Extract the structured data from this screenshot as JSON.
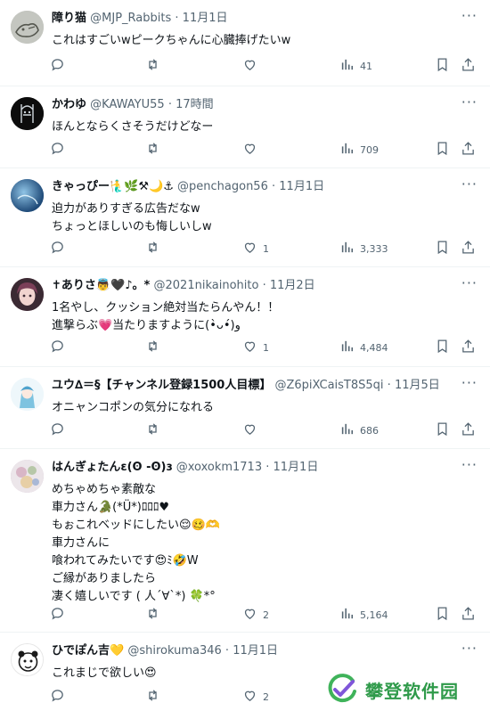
{
  "tweets": [
    {
      "name": "障り猫",
      "handle": "@MJP_Rabbits",
      "time": "11月1日",
      "lines": [
        "これはすごいwピークちゃんに心臓捧げたいw"
      ],
      "replies": "",
      "retweets": "",
      "likes": "",
      "views": "41",
      "avatar_color": "#b8bab4"
    },
    {
      "name": "かわゆ",
      "handle": "@KAWAYU55",
      "time": "17時間",
      "lines": [
        "ほんとならくさそうだけどなー"
      ],
      "replies": "",
      "retweets": "",
      "likes": "",
      "views": "709",
      "avatar_color": "#111111"
    },
    {
      "name": "きゃっぴー🧜‍♂️🌿⚒🌙⚓",
      "handle": "@penchagon56",
      "time": "11月1日",
      "lines": [
        "迫力がありすぎる広告だなw",
        "ちょっとほしいのも悔しいしw"
      ],
      "replies": "",
      "retweets": "",
      "likes": "1",
      "views": "3,333",
      "avatar_color": "#2e5f8f"
    },
    {
      "name": "✝ありさ👼🖤♪。*",
      "handle": "@2021nikainohito",
      "time": "11月2日",
      "lines": [
        "1名やし、クッション絶対当たらんやん！！",
        "進撃らぶ💗当たりますように(•̀ᴗ•́)و"
      ],
      "replies": "",
      "retweets": "",
      "likes": "1",
      "views": "4,484",
      "avatar_color": "#8a5a6a"
    },
    {
      "name": "ユウ∆＝§【チャンネル登録1500人目標】",
      "handle": "@Z6piXCaisT8S5qi",
      "time": "11月5日",
      "lines": [
        "オニャンコポンの気分になれる"
      ],
      "replies": "",
      "retweets": "",
      "likes": "",
      "views": "686",
      "avatar_color": "#7ec3e0"
    },
    {
      "name": "はんぎょたんɛ(ʘ -ʘ)ɜ",
      "handle": "@xoxokm1713",
      "time": "11月1日",
      "lines": [
        "めちゃめちゃ素敵な",
        "車力さん🐊(*Ü*)ﾛﾛﾛ♥",
        "もぉこれベッドにしたい😌🥴🫶",
        "車力さんに",
        "喰われてみたいです😍ﾐ🤣W",
        "ご縁がありましたら",
        "凄く嬉しいです ( 人´∀`*) 🍀*°"
      ],
      "replies": "",
      "retweets": "",
      "likes": "2",
      "views": "5,164",
      "avatar_color": "#c9b4c8"
    },
    {
      "name": "ひでぽん吉💛",
      "handle": "@shirokuma346",
      "time": "11月1日",
      "lines": [
        "これまじで欲しい😍"
      ],
      "replies": "",
      "retweets": "",
      "likes": "2",
      "views": "",
      "avatar_color": "#ffffff"
    }
  ],
  "icons": {
    "reply": "reply-icon",
    "retweet": "retweet-icon",
    "like": "like-icon",
    "views": "views-icon",
    "bookmark": "bookmark-icon",
    "share": "share-icon",
    "more": "more-icon"
  },
  "watermark": {
    "text": "攀登软件园"
  },
  "colors": {
    "muted": "#536471",
    "divider": "#eff3f4",
    "watermark": "#2f9a4a"
  }
}
